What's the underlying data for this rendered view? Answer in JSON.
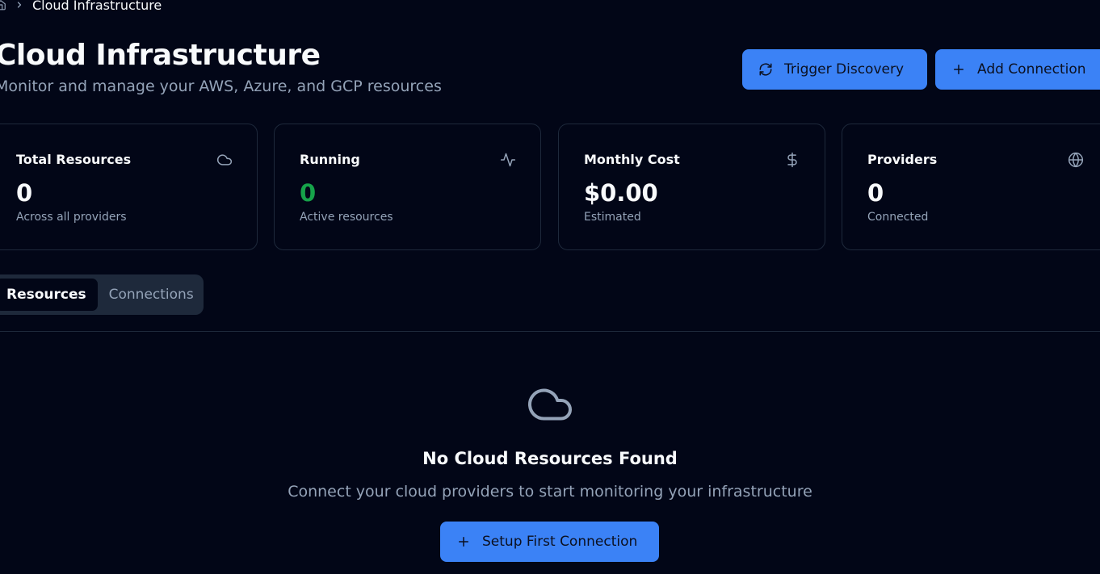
{
  "breadcrumb": {
    "home_icon": "home-icon",
    "current": "Cloud Infrastructure"
  },
  "header": {
    "title": "Cloud Infrastructure",
    "subtitle": "Monitor and manage your AWS, Azure, and GCP resources",
    "trigger_discovery_label": "Trigger Discovery",
    "trigger_discovery_icon": "refresh-icon",
    "add_connection_label": "Add Connection",
    "add_connection_icon": "plus-icon"
  },
  "stats": [
    {
      "title": "Total Resources",
      "value": "0",
      "subtitle": "Across all providers",
      "icon": "cloud-icon"
    },
    {
      "title": "Running",
      "value": "0",
      "subtitle": "Active resources",
      "icon": "activity-icon",
      "value_color": "#16a34a"
    },
    {
      "title": "Monthly Cost",
      "value": "$0.00",
      "subtitle": "Estimated",
      "icon": "dollar-icon"
    },
    {
      "title": "Providers",
      "value": "0",
      "subtitle": "Connected",
      "icon": "globe-icon"
    }
  ],
  "tabs": [
    {
      "label": "Resources",
      "active": true
    },
    {
      "label": "Connections",
      "active": false
    }
  ],
  "empty_state": {
    "icon": "cloud-icon",
    "title": "No Cloud Resources Found",
    "subtitle": "Connect your cloud providers to start monitoring your infrastructure",
    "button_label": "Setup First Connection",
    "button_icon": "plus-icon"
  },
  "colors": {
    "background": "#020617",
    "accent": "#3b82f6",
    "border": "#1e293b",
    "muted_text": "#94a3b8",
    "success": "#16a34a"
  }
}
